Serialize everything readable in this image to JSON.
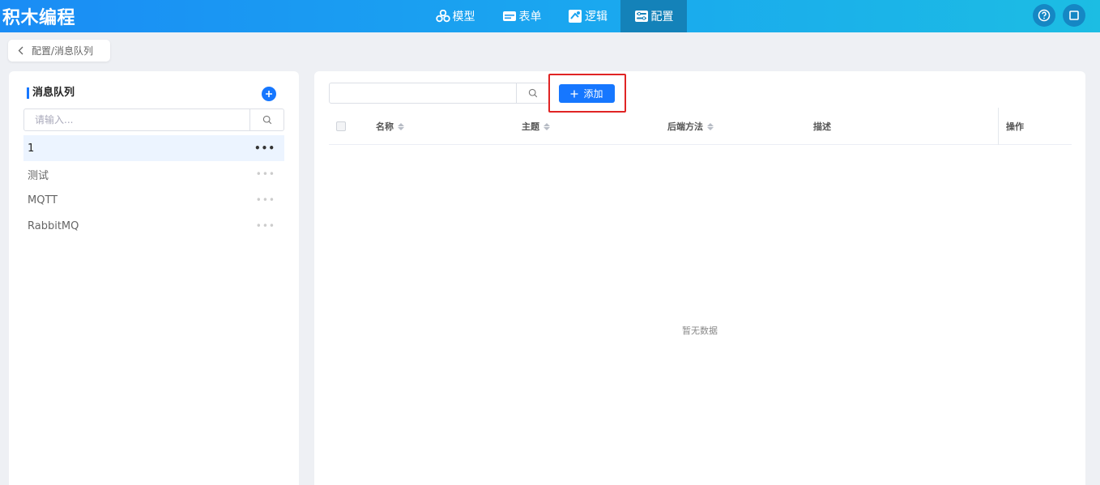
{
  "app": {
    "title": "积木编程"
  },
  "nav": {
    "items": [
      {
        "label": "模型",
        "icon": "cubes-icon"
      },
      {
        "label": "表单",
        "icon": "form-icon"
      },
      {
        "label": "逻辑",
        "icon": "logic-icon"
      },
      {
        "label": "配置",
        "icon": "config-icon",
        "active": true
      }
    ]
  },
  "header_actions": {
    "help_icon": "help-icon",
    "window_icon": "square-icon"
  },
  "breadcrumb": {
    "text": "配置/消息队列"
  },
  "left_panel": {
    "title": "消息队列",
    "search_placeholder": "请输入...",
    "items": [
      {
        "label": "1",
        "selected": true
      },
      {
        "label": "测试"
      },
      {
        "label": "MQTT"
      },
      {
        "label": "RabbitMQ"
      }
    ]
  },
  "right_panel": {
    "search_value": "",
    "add_label": "添加",
    "columns": [
      "名称",
      "主题",
      "后端方法",
      "描述",
      "操作"
    ],
    "empty_text": "暂无数据"
  },
  "colors": {
    "primary": "#1677ff",
    "highlight": "#e02424",
    "topbar_start": "#1a8cf5",
    "topbar_end": "#1cbde3"
  }
}
